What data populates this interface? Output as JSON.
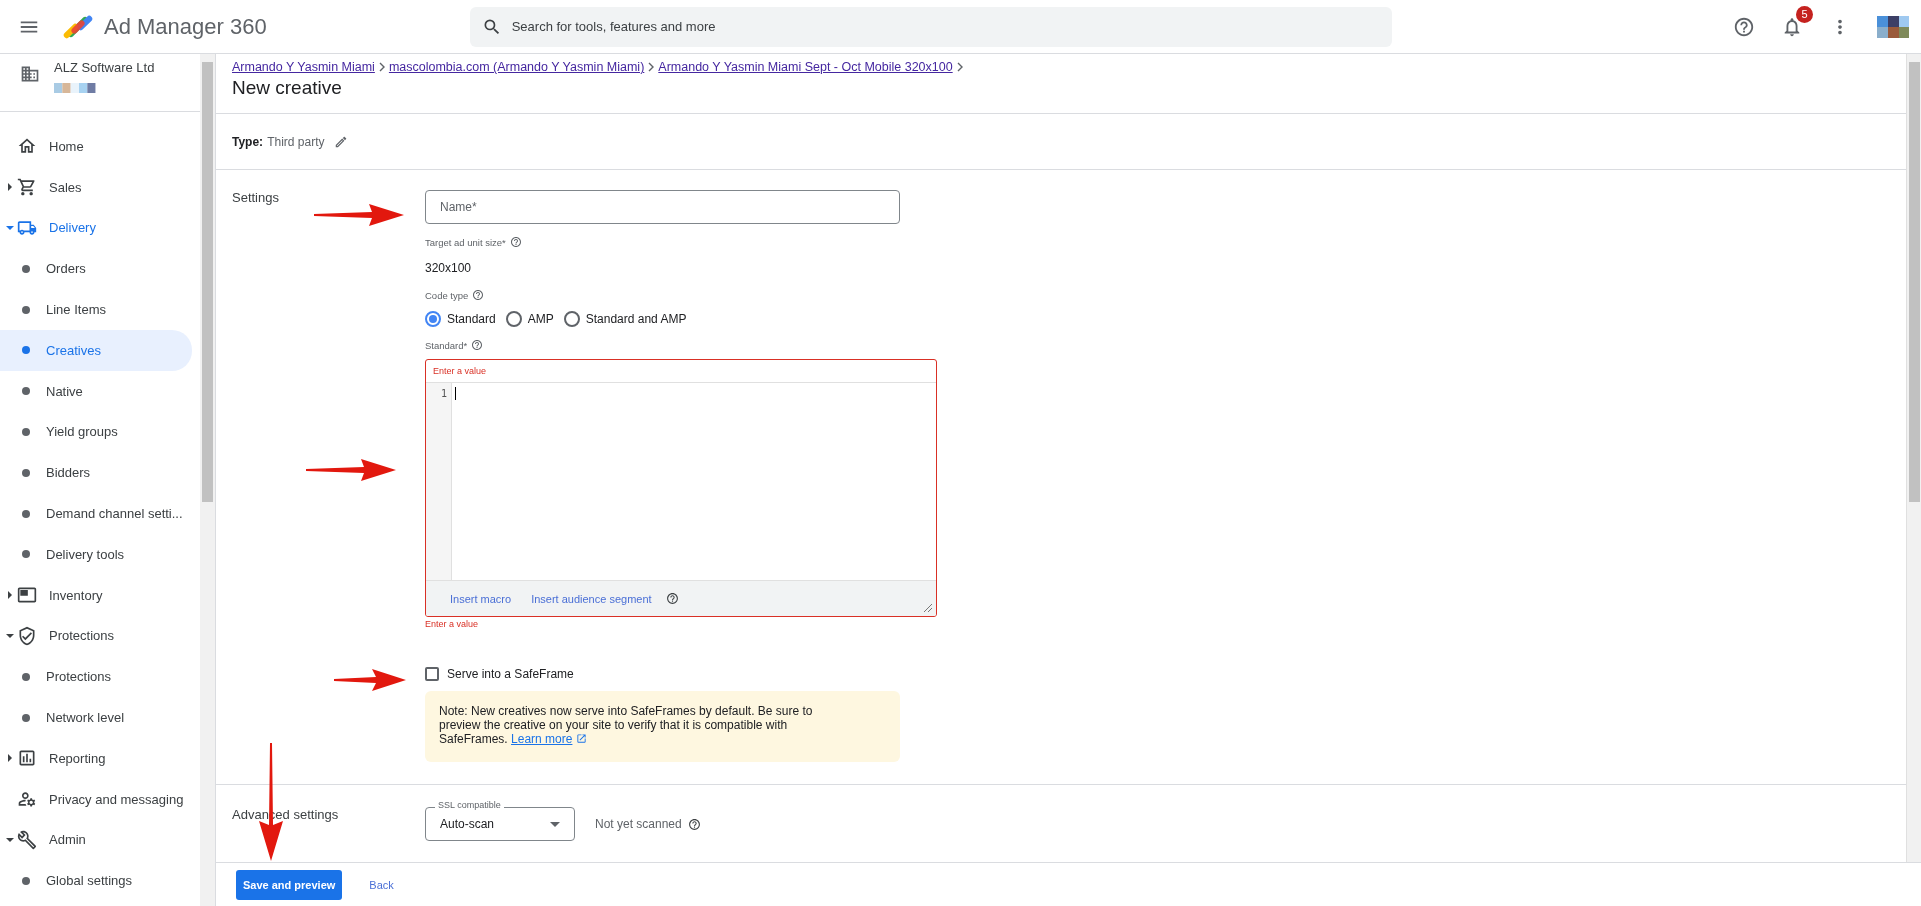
{
  "app": {
    "title": "Ad Manager 360",
    "search_placeholder": "Search for tools, features and more",
    "notification_count": "5"
  },
  "account": {
    "name": "ALZ Software Ltd"
  },
  "sidebar": {
    "items": [
      {
        "kind": "link",
        "label": "Home",
        "selected": false
      },
      {
        "kind": "section",
        "label": "Sales",
        "expanded": false,
        "selected": false
      },
      {
        "kind": "section",
        "label": "Delivery",
        "expanded": true,
        "selected": false,
        "children": [
          {
            "kind": "child",
            "label": "Orders",
            "selected": false
          },
          {
            "kind": "child",
            "label": "Line Items",
            "selected": false
          },
          {
            "kind": "child",
            "label": "Creatives",
            "selected": true
          },
          {
            "kind": "child",
            "label": "Native",
            "selected": false
          },
          {
            "kind": "child",
            "label": "Yield groups",
            "selected": false
          },
          {
            "kind": "child",
            "label": "Bidders",
            "selected": false
          },
          {
            "kind": "child",
            "label": "Demand channel setti...",
            "selected": false
          },
          {
            "kind": "child",
            "label": "Delivery tools",
            "selected": false
          }
        ]
      },
      {
        "kind": "section",
        "label": "Inventory",
        "expanded": false,
        "selected": false
      },
      {
        "kind": "section",
        "label": "Protections",
        "expanded": true,
        "selected": false,
        "children": [
          {
            "kind": "child",
            "label": "Protections",
            "selected": false
          },
          {
            "kind": "child",
            "label": "Network level",
            "selected": false
          }
        ]
      },
      {
        "kind": "section",
        "label": "Reporting",
        "expanded": false,
        "selected": false
      },
      {
        "kind": "link",
        "label": "Privacy and messaging",
        "selected": false
      },
      {
        "kind": "section",
        "label": "Admin",
        "expanded": true,
        "selected": false,
        "children": [
          {
            "kind": "child",
            "label": "Global settings",
            "selected": false
          }
        ]
      }
    ]
  },
  "breadcrumbs": [
    "Armando Y Yasmin Miami",
    "mascolombia.com (Armando Y Yasmin Miami)",
    "Armando Y Yasmin Miami Sept - Oct Mobile 320x100"
  ],
  "page_title": "New creative",
  "type": {
    "label": "Type:",
    "value": "Third party"
  },
  "settings": {
    "heading": "Settings",
    "name_field": {
      "placeholder": "Name*"
    },
    "target_size": {
      "label": "Target ad unit size*",
      "value": "320x100"
    },
    "code_type": {
      "label": "Code type",
      "options": [
        {
          "label": "Standard",
          "selected": true
        },
        {
          "label": "AMP",
          "selected": false
        },
        {
          "label": "Standard and AMP",
          "selected": false
        }
      ]
    },
    "code_editor": {
      "label": "Standard*",
      "header_error": "Enter a value",
      "line_number": "1",
      "links": [
        "Insert macro",
        "Insert audience segment"
      ],
      "error": "Enter a value"
    },
    "safeframe": {
      "label": "Serve into a SafeFrame",
      "checked": false
    },
    "note": {
      "text": "Note: New creatives now serve into SafeFrames by default. Be sure to preview the creative on your site to verify that it is compatible with SafeFrames.",
      "link": "Learn more"
    }
  },
  "advanced": {
    "heading": "Advanced settings",
    "ssl_select": {
      "label": "SSL compatible",
      "value": "Auto-scan"
    },
    "scan_status": "Not yet scanned"
  },
  "footer": {
    "buttons": [
      {
        "label": "Save and preview",
        "kind": "primary"
      },
      {
        "label": "Back",
        "kind": "text"
      }
    ]
  }
}
